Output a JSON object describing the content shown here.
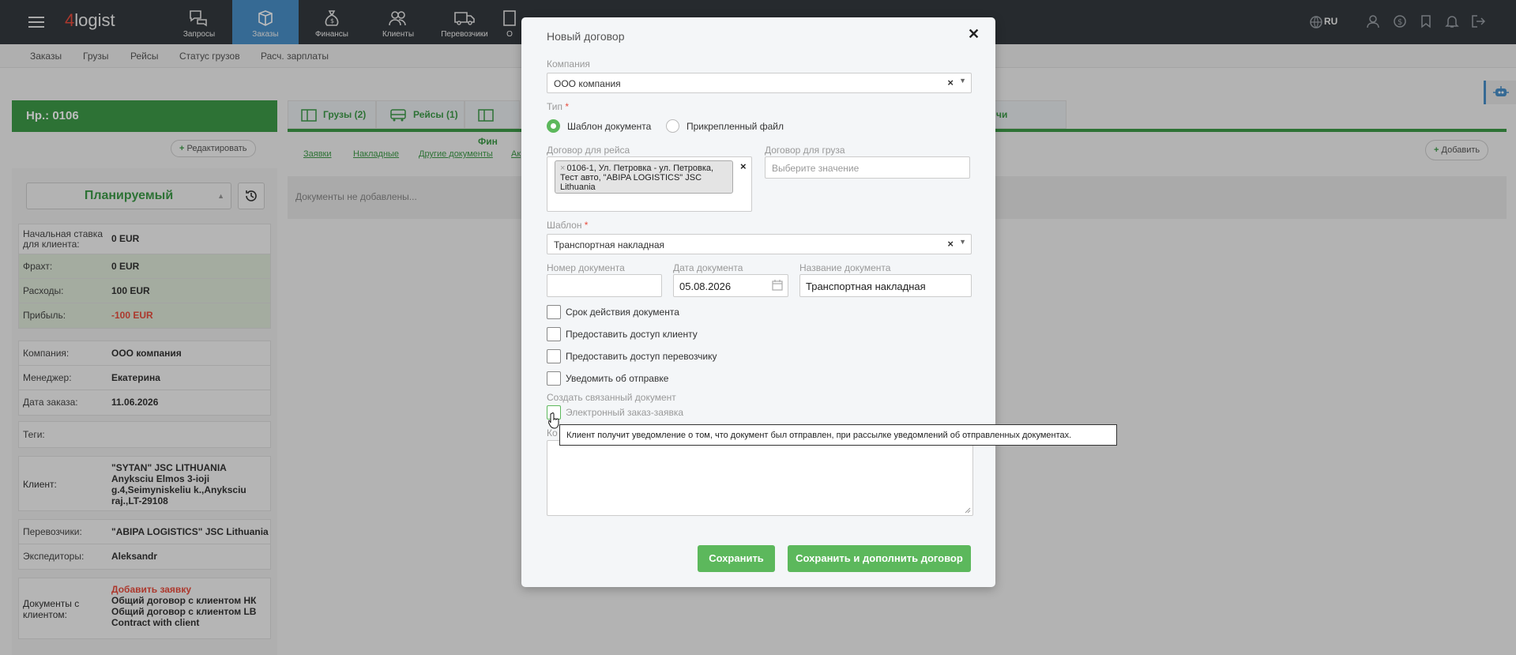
{
  "app": {
    "logo_num": "4",
    "logo_text": "logist"
  },
  "nav": [
    {
      "label": "Запросы"
    },
    {
      "label": "Заказы"
    },
    {
      "label": "Финансы"
    },
    {
      "label": "Клиенты"
    },
    {
      "label": "Перевозчики"
    },
    {
      "label": "О"
    }
  ],
  "lang": "RU",
  "subnav": [
    "Заказы",
    "Грузы",
    "Рейсы",
    "Статус грузов",
    "Расч. зарплаты"
  ],
  "order": {
    "number": "Нр.: 0106",
    "edit_label": "Редактировать",
    "status": "Планируемый",
    "finance": [
      {
        "label": "Начальная ставка для клиента:",
        "value": "0 EUR"
      },
      {
        "label": "Фрахт:",
        "value": "0 EUR"
      },
      {
        "label": "Расходы:",
        "value": "100 EUR"
      },
      {
        "label": "Прибыль:",
        "value": "-100 EUR"
      }
    ],
    "info": [
      {
        "label": "Компания:",
        "value": "ООО компания"
      },
      {
        "label": "Менеджер:",
        "value": "Екатерина"
      },
      {
        "label": "Дата заказа:",
        "value": "11.06.2026"
      }
    ],
    "tags_label": "Теги:",
    "client_label": "Клиент:",
    "client_value": "\"SYTAN\" JSC LITHUANIA Anyksciu Elmos 3-ioji g.4,Seimyniskeliu k.,Anyksciu raj.,LT-29108",
    "carriers_label": "Перевозчики:",
    "carriers_value": "\"ABIPA LOGISTICS\" JSC Lithuania",
    "forwarders_label": "Экспедиторы:",
    "forwarders_value": "Aleksandr",
    "docs_label": "Документы с клиентом:",
    "docs_add": "Добавить заявку",
    "docs": [
      "Общий договор с клиентом НК",
      "Общий договор с клиентом LB",
      "Contract with client"
    ]
  },
  "tabs": [
    "Грузы (2)",
    "Рейсы (1)",
    "Фин",
    "чи"
  ],
  "subtabs": [
    "Заявки",
    "Накладные",
    "Другие документы",
    "Ак"
  ],
  "add_label": "Добавить",
  "no_docs": "Документы не добавлены...",
  "modal": {
    "title": "Новый договор",
    "company_label": "Компания",
    "company_value": "ООО компания",
    "type_label": "Тип",
    "type_opt1": "Шаблон документа",
    "type_opt2": "Прикрепленный файл",
    "trip_contract_label": "Договор для рейса",
    "trip_tag": "0106-1, Ул. Петровка - ул. Петровка, Тест авто, \"ABIPA LOGISTICS\" JSC Lithuania",
    "cargo_contract_label": "Договор для груза",
    "cargo_placeholder": "Выберите значение",
    "template_label": "Шаблон",
    "template_value": "Транспортная накладная",
    "doc_number_label": "Номер документа",
    "doc_date_label": "Дата документа",
    "doc_date_value": "05.08.2026",
    "doc_name_label": "Название документа",
    "doc_name_value": "Транспортная накладная",
    "checkboxes": [
      "Срок действия документа",
      "Предоставить доступ клиенту",
      "Предоставить доступ перевозчику",
      "Уведомить об отправке"
    ],
    "linked_label": "Создать связанный документ",
    "linked_option": "Электронный заказ-заявка",
    "comment_label": "Ко",
    "tooltip": "Клиент получит уведомление о том, что документ был отправлен, при рассылке уведомлений об отправленных документах.",
    "save_label": "Сохранить",
    "save_more_label": "Сохранить и дополнить договор"
  },
  "colors": {
    "accent_green": "#3d9a48",
    "button_green": "#5cb85c",
    "topbar": "#34393e",
    "active_nav": "#4a90c8",
    "negative": "#e84c3d"
  }
}
